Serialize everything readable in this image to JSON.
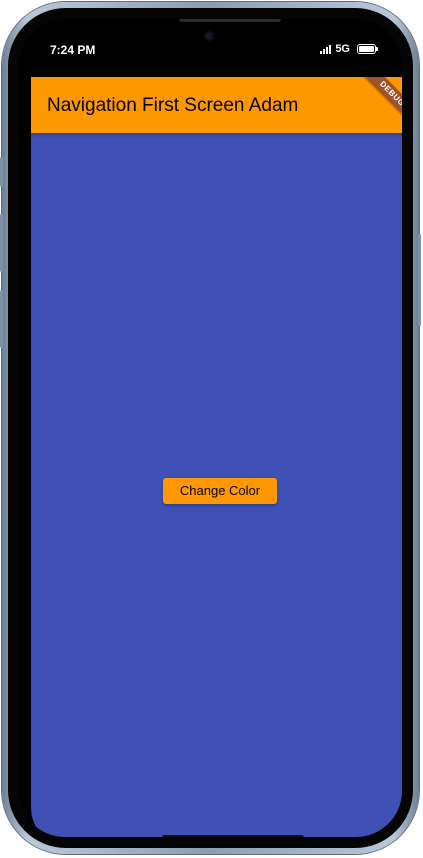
{
  "status_bar": {
    "time": "7:24 PM",
    "network": "5G"
  },
  "app_bar": {
    "title": "Navigation First Screen Adam",
    "background_color": "#ff9800"
  },
  "debug_banner": {
    "label": "DEBUG",
    "color": "#a0522d"
  },
  "body": {
    "background_color": "#3f51b5",
    "button_label": "Change Color",
    "button_color": "#ff9800"
  }
}
